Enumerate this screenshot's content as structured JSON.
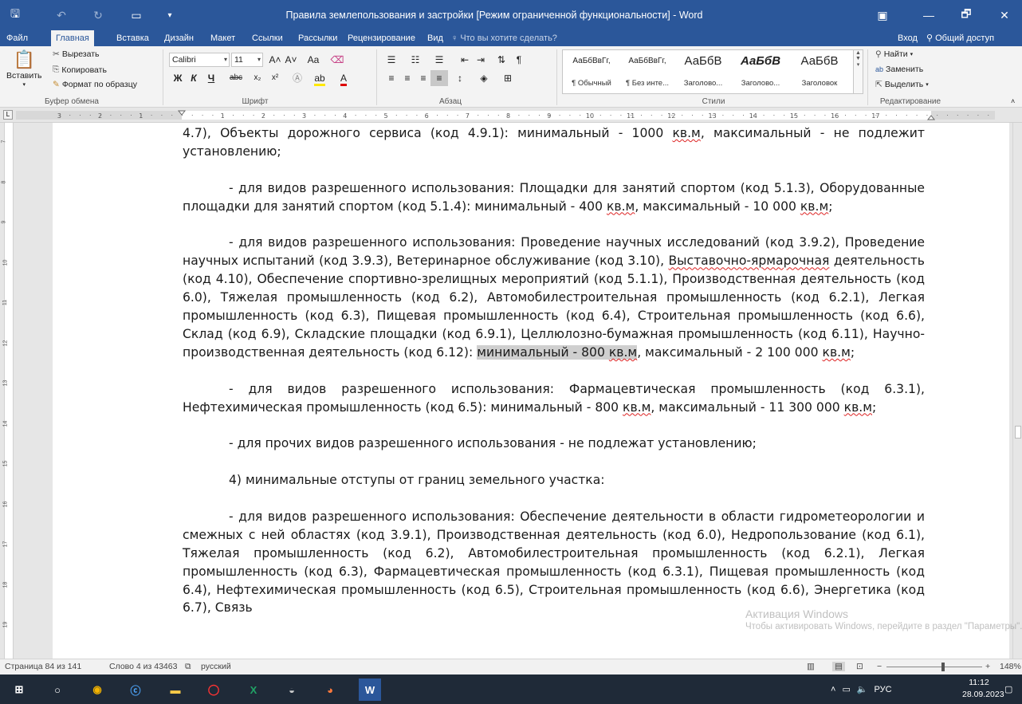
{
  "window": {
    "title": "Правила землепользования и застройки [Режим ограниченной функциональности] - Word",
    "quick_access": {
      "save": "🖫",
      "undo": "↶",
      "redo": "↻",
      "layout": "▭",
      "more": "▾"
    },
    "controls": {
      "ribbon_display": "▣",
      "minimize": "—",
      "maximize": "🗗",
      "close": "✕"
    }
  },
  "tabs": {
    "file": "Файл",
    "home": "Главная",
    "insert": "Вставка",
    "design": "Дизайн",
    "layout": "Макет",
    "references": "Ссылки",
    "mailings": "Рассылки",
    "review": "Рецензирование",
    "view": "Вид",
    "tell_me": "Что вы хотите сделать?",
    "sign_in": "Вход",
    "share": "Общий доступ"
  },
  "ribbon": {
    "clipboard": {
      "paste": "Вставить",
      "cut": "Вырезать",
      "copy": "Копировать",
      "format_painter": "Формат по образцу",
      "label": "Буфер обмена"
    },
    "font": {
      "name": "Calibri",
      "size": "11",
      "label": "Шрифт",
      "case": "Aa",
      "bold": "Ж",
      "italic": "К",
      "underline": "Ч",
      "strike": "abc",
      "subscript": "x₂",
      "superscript": "x²"
    },
    "paragraph": {
      "label": "Абзац"
    },
    "styles": {
      "label": "Стили",
      "items": [
        {
          "sample": "АаБбВвГг,",
          "name": "¶ Обычный"
        },
        {
          "sample": "АаБбВвГг,",
          "name": "¶ Без инте..."
        },
        {
          "sample": "АаБбВ",
          "name": "Заголово..."
        },
        {
          "sample": "АаБбВ",
          "name": "Заголово..."
        },
        {
          "sample": "АаБбВ",
          "name": "Заголовок"
        }
      ]
    },
    "editing": {
      "find": "Найти",
      "replace": "Заменить",
      "select": "Выделить",
      "label": "Редактирование"
    }
  },
  "ruler": {
    "h_numbers": [
      "3",
      "2",
      "1",
      "1",
      "2",
      "3",
      "4",
      "5",
      "6",
      "7",
      "8",
      "9",
      "10",
      "11",
      "12",
      "13",
      "14",
      "15",
      "16",
      "17"
    ],
    "v_numbers": [
      "7",
      "8",
      "9",
      "10",
      "11",
      "12",
      "13",
      "14",
      "15",
      "16",
      "17",
      "18",
      "19",
      "20"
    ],
    "tab_selector": "L"
  },
  "doc": {
    "p0": {
      "a": "4.7), Объекты дорожного сервиса (код 4.9.1): минимальный - 1000 ",
      "sp": "кв.м",
      "b": ", максимальный - не подлежит установлению;"
    },
    "p1": {
      "a": "- для видов разрешенного использования: Площадки для занятий спортом (код 5.1.3), Оборудованные площадки для занятий спортом (код 5.1.4): минимальный - 400 ",
      "sp1": "кв.м",
      "b": ", максимальный - 10 000 ",
      "sp2": "кв.м",
      "c": ";"
    },
    "p2": {
      "a": "- для видов разрешенного использования: Проведение научных исследований (код 3.9.2), Проведение научных испытаний (код 3.9.3), Ветеринарное обслуживание (код 3.10), ",
      "sp1": "Выставочно-ярмарочная",
      "b": " деятельность (код 4.10), Обеспечение спортивно-зрелищных мероприятий (код 5.1.1), Производственная деятельность (код 6.0), Тяжелая промышленность (код 6.2), Автомобилестроительная промышленность (код 6.2.1), Легкая промышленность (код 6.3), Пищевая промышленность (код 6.4), Строительная промышленность (код 6.6), Склад (код 6.9), Складские площадки (код 6.9.1), Целлюлозно-бумажная промышленность (код 6.11), Научно-производственная деятельность (код 6.12): ",
      "hl_a": "минимальный - 800 ",
      "hl_sp": "кв.м",
      "c": ", максимальный - 2 100 000 ",
      "sp2": "кв.м",
      "d": ";"
    },
    "p3": {
      "a": "- для видов разрешенного использования: Фармацевтическая промышленность (код 6.3.1), Нефтехимическая промышленность (код 6.5): минимальный - 800 ",
      "sp1": "кв.м",
      "b": ", максимальный - 11 300 000 ",
      "sp2": "кв.м",
      "c": ";"
    },
    "p4": "- для прочих видов разрешенного использования - не подлежат установлению;",
    "p5": "4) минимальные отступы от границ земельного участка:",
    "p6": "- для видов разрешенного использования: Обеспечение деятельности в области гидрометеорологии и смежных с ней областях (код 3.9.1), Производственная деятельность (код 6.0), Недропользование (код 6.1), Тяжелая промышленность (код 6.2), Автомобилестроительная промышленность (код 6.2.1), Легкая промышленность (код 6.3), Фармацевтическая промышленность (код 6.3.1), Пищевая промышленность (код 6.4), Нефтехимическая промышленность (код 6.5), Строительная промышленность (код 6.6), Энергетика (код 6.7), Связь"
  },
  "watermark": {
    "line1": "Активация Windows",
    "line2": "Чтобы активировать Windows, перейдите в раздел \"Параметры\"."
  },
  "status": {
    "page": "Страница 84 из 141",
    "words": "Слово 4 из 43463",
    "language": "русский",
    "zoom": "148%",
    "zoom_minus": "−",
    "zoom_plus": "+"
  },
  "taskbar": {
    "lang": "РУС",
    "time": "11:12",
    "date": "28.09.2023"
  },
  "colors": {
    "word_blue": "#2b579a",
    "taskbar": "#1f2a38",
    "spellcheck": "#dd2222"
  }
}
